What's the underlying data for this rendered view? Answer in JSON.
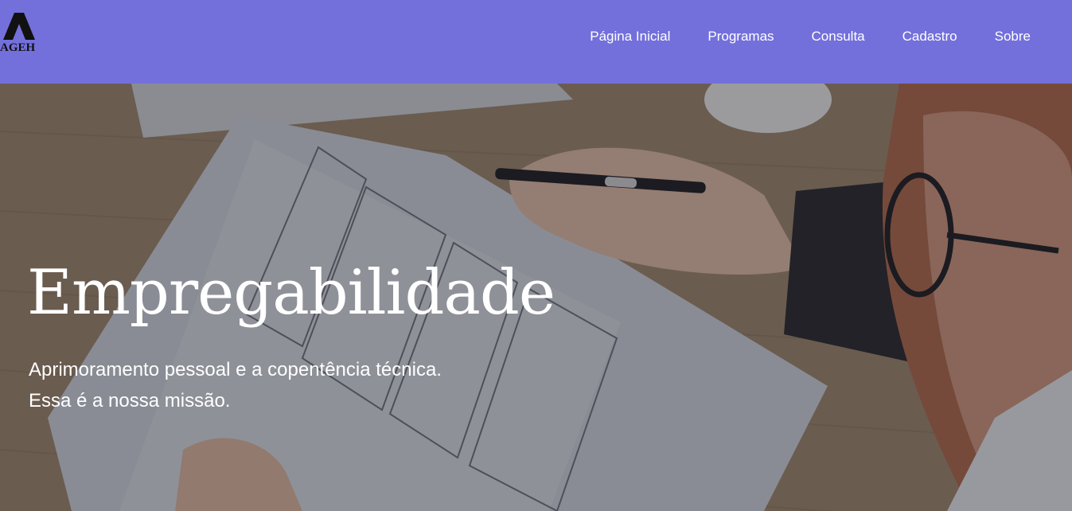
{
  "brand": {
    "logo_text": "AGEH"
  },
  "nav": {
    "items": [
      {
        "label": "Página Inicial"
      },
      {
        "label": "Programas"
      },
      {
        "label": "Consulta"
      },
      {
        "label": "Cadastro"
      },
      {
        "label": "Sobre"
      }
    ]
  },
  "hero": {
    "title": "Empregabilidade",
    "subtitle_line1": "Aprimoramento pessoal e a copentência técnica.",
    "subtitle_line2": "Essa é a nossa missão."
  },
  "colors": {
    "navbar": "#7370dc",
    "text": "#ffffff"
  }
}
